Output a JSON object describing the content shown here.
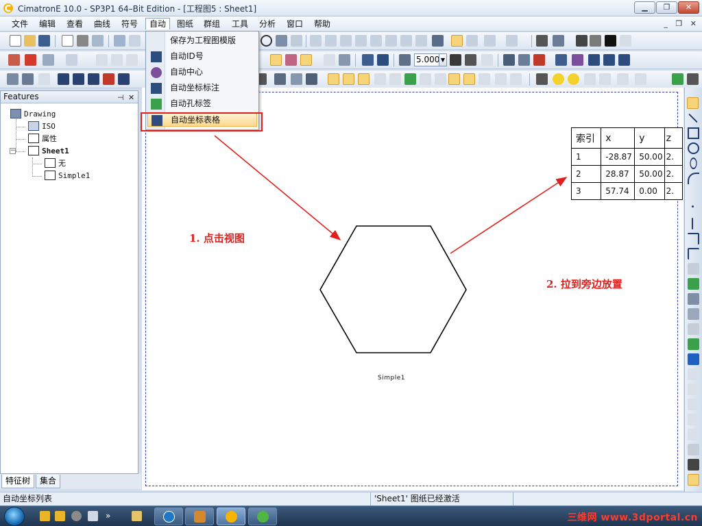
{
  "window": {
    "title": "CimatronE 10.0 - SP3P1 64–Bit Edition - [工程图5 : Sheet1]",
    "min_glyph": "▁",
    "max_glyph": "❐",
    "close_glyph": "✕"
  },
  "menu": {
    "items": [
      "文件",
      "编辑",
      "查看",
      "曲线",
      "符号",
      "自动",
      "图纸",
      "群组",
      "工具",
      "分析",
      "窗口",
      "帮助"
    ],
    "mdi_controls": "_ ❐ ✕"
  },
  "auto_menu": {
    "items": [
      {
        "label": "保存为工程图模版"
      },
      {
        "label": "自动ID号"
      },
      {
        "label": "自动中心"
      },
      {
        "label": "自动坐标标注"
      },
      {
        "label": "自动孔标签"
      },
      {
        "label": "自动坐标表格"
      }
    ]
  },
  "toolbar": {
    "scale_value": "5.000"
  },
  "features_panel": {
    "title": "Features",
    "pin_glyph": "⊣",
    "close_glyph": "✕",
    "tree": {
      "root": "Drawing",
      "iso": "ISO",
      "props": "属性",
      "sheet": "Sheet1",
      "none": "无",
      "view": "Simple1"
    },
    "tabs": [
      "特征树",
      "集合"
    ]
  },
  "drawing": {
    "view_label": "Simple1",
    "table": {
      "headers": [
        "索引",
        "x",
        "y",
        "z"
      ],
      "rows": [
        [
          "1",
          "-28.87",
          "50.00",
          "2."
        ],
        [
          "2",
          "28.87",
          "50.00",
          "2."
        ],
        [
          "3",
          "57.74",
          "0.00",
          "2."
        ]
      ]
    },
    "annotation_1": "1. 点击视图",
    "annotation_2": "2. 拉到旁边放置"
  },
  "status": {
    "left": "自动坐标列表",
    "middle": "'Sheet1' 图纸已经激活"
  },
  "taskbar": {
    "overflow": "»",
    "watermark": "三维网 www.3dportal.cn"
  },
  "colors": {
    "annotation_red": "#e0201c",
    "frame_blue": "#3346a8",
    "menu_highlight": "#fbd98f"
  }
}
